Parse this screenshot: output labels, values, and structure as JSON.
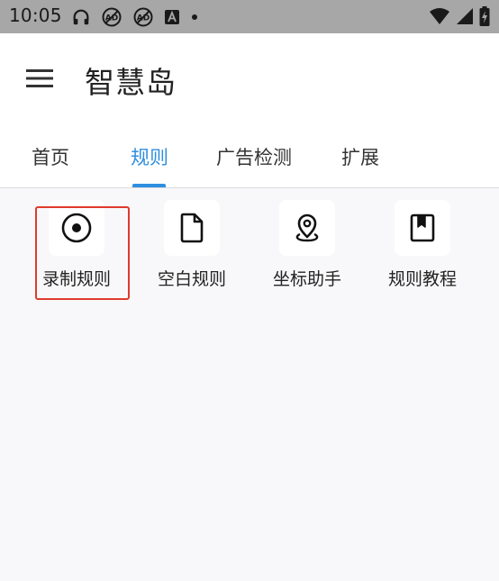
{
  "status_bar": {
    "time": "10:05",
    "icons": [
      "headphones-icon",
      "no-sync-icon",
      "no-sync-icon",
      "font-icon",
      "dot-icon",
      "wifi-icon",
      "signal-icon",
      "battery-charging-icon"
    ]
  },
  "app_bar": {
    "title": "智慧岛",
    "menu_icon": "hamburger-menu-icon"
  },
  "tabs": [
    {
      "label": "首页",
      "active": false
    },
    {
      "label": "规则",
      "active": true
    },
    {
      "label": "广告检测",
      "active": false
    },
    {
      "label": "扩展",
      "active": false
    }
  ],
  "tools": [
    {
      "label": "录制规则",
      "icon": "record-icon",
      "highlighted": true
    },
    {
      "label": "空白规则",
      "icon": "blank-document-icon"
    },
    {
      "label": "坐标助手",
      "icon": "location-pin-icon"
    },
    {
      "label": "规则教程",
      "icon": "bookmark-book-icon"
    }
  ],
  "colors": {
    "accent": "#2f8fe0",
    "highlight": "#e03a2c",
    "status_bar": "#a7a7a7"
  }
}
